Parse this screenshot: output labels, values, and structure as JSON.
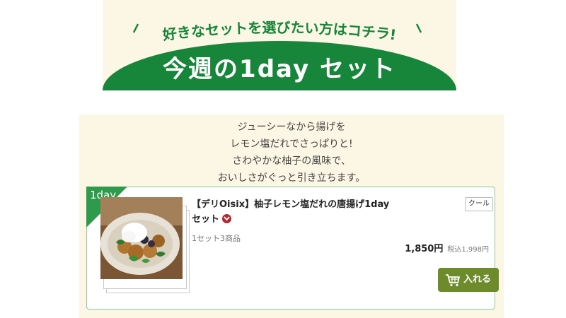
{
  "banner": {
    "slogan": "好きなセットを選びたい方はコチラ!",
    "title": "今週の1day セット"
  },
  "description": {
    "lines": [
      "ジューシーなから揚げを",
      "レモン塩だれでさっぱりと!",
      "さわやかな柚子の風味で、",
      "おいしさがぐっと引き立ちます。"
    ]
  },
  "product": {
    "ribbon": "1day",
    "title_line1": "【デリOisix】柚子レモン塩だれの唐揚げ1day",
    "title_line2": "セット",
    "badge": "クール",
    "count": "1セット3商品",
    "price": "1,850円",
    "tax_price": "税込1,998円",
    "add_button": "入れる",
    "expand_icon": "chevron-down-icon",
    "cart_icon": "cart-icon",
    "product_photo": "karaage-dish-photo"
  },
  "colors": {
    "brand_green": "#17853a",
    "panel_bg": "#fbf7e4",
    "button_olive": "#6e8b2c",
    "chevron_red": "#b3282d"
  }
}
